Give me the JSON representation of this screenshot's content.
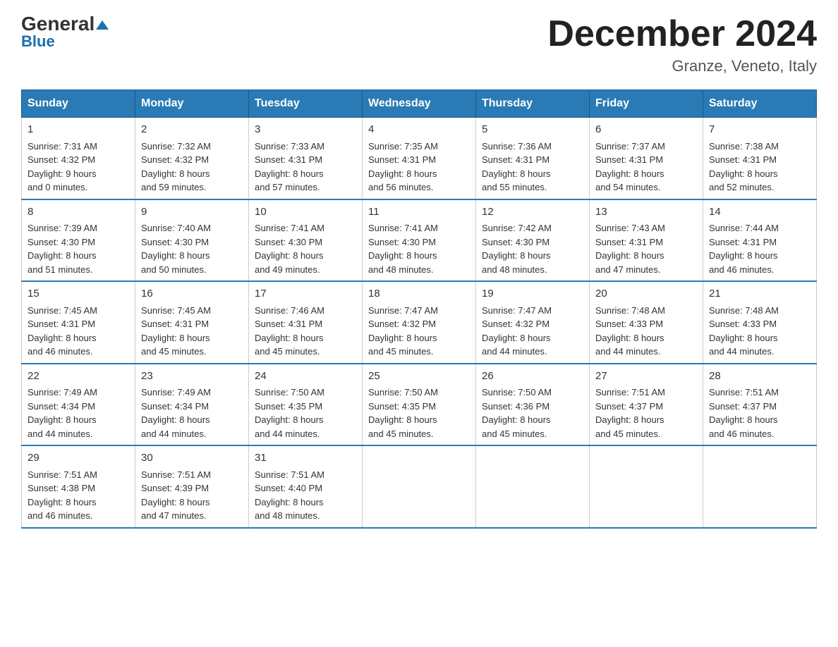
{
  "header": {
    "logo_general": "General",
    "logo_blue": "Blue",
    "main_title": "December 2024",
    "subtitle": "Granze, Veneto, Italy"
  },
  "days_of_week": [
    "Sunday",
    "Monday",
    "Tuesday",
    "Wednesday",
    "Thursday",
    "Friday",
    "Saturday"
  ],
  "weeks": [
    [
      {
        "day": "1",
        "sunrise": "7:31 AM",
        "sunset": "4:32 PM",
        "daylight": "9 hours and 0 minutes."
      },
      {
        "day": "2",
        "sunrise": "7:32 AM",
        "sunset": "4:32 PM",
        "daylight": "8 hours and 59 minutes."
      },
      {
        "day": "3",
        "sunrise": "7:33 AM",
        "sunset": "4:31 PM",
        "daylight": "8 hours and 57 minutes."
      },
      {
        "day": "4",
        "sunrise": "7:35 AM",
        "sunset": "4:31 PM",
        "daylight": "8 hours and 56 minutes."
      },
      {
        "day": "5",
        "sunrise": "7:36 AM",
        "sunset": "4:31 PM",
        "daylight": "8 hours and 55 minutes."
      },
      {
        "day": "6",
        "sunrise": "7:37 AM",
        "sunset": "4:31 PM",
        "daylight": "8 hours and 54 minutes."
      },
      {
        "day": "7",
        "sunrise": "7:38 AM",
        "sunset": "4:31 PM",
        "daylight": "8 hours and 52 minutes."
      }
    ],
    [
      {
        "day": "8",
        "sunrise": "7:39 AM",
        "sunset": "4:30 PM",
        "daylight": "8 hours and 51 minutes."
      },
      {
        "day": "9",
        "sunrise": "7:40 AM",
        "sunset": "4:30 PM",
        "daylight": "8 hours and 50 minutes."
      },
      {
        "day": "10",
        "sunrise": "7:41 AM",
        "sunset": "4:30 PM",
        "daylight": "8 hours and 49 minutes."
      },
      {
        "day": "11",
        "sunrise": "7:41 AM",
        "sunset": "4:30 PM",
        "daylight": "8 hours and 48 minutes."
      },
      {
        "day": "12",
        "sunrise": "7:42 AM",
        "sunset": "4:30 PM",
        "daylight": "8 hours and 48 minutes."
      },
      {
        "day": "13",
        "sunrise": "7:43 AM",
        "sunset": "4:31 PM",
        "daylight": "8 hours and 47 minutes."
      },
      {
        "day": "14",
        "sunrise": "7:44 AM",
        "sunset": "4:31 PM",
        "daylight": "8 hours and 46 minutes."
      }
    ],
    [
      {
        "day": "15",
        "sunrise": "7:45 AM",
        "sunset": "4:31 PM",
        "daylight": "8 hours and 46 minutes."
      },
      {
        "day": "16",
        "sunrise": "7:45 AM",
        "sunset": "4:31 PM",
        "daylight": "8 hours and 45 minutes."
      },
      {
        "day": "17",
        "sunrise": "7:46 AM",
        "sunset": "4:31 PM",
        "daylight": "8 hours and 45 minutes."
      },
      {
        "day": "18",
        "sunrise": "7:47 AM",
        "sunset": "4:32 PM",
        "daylight": "8 hours and 45 minutes."
      },
      {
        "day": "19",
        "sunrise": "7:47 AM",
        "sunset": "4:32 PM",
        "daylight": "8 hours and 44 minutes."
      },
      {
        "day": "20",
        "sunrise": "7:48 AM",
        "sunset": "4:33 PM",
        "daylight": "8 hours and 44 minutes."
      },
      {
        "day": "21",
        "sunrise": "7:48 AM",
        "sunset": "4:33 PM",
        "daylight": "8 hours and 44 minutes."
      }
    ],
    [
      {
        "day": "22",
        "sunrise": "7:49 AM",
        "sunset": "4:34 PM",
        "daylight": "8 hours and 44 minutes."
      },
      {
        "day": "23",
        "sunrise": "7:49 AM",
        "sunset": "4:34 PM",
        "daylight": "8 hours and 44 minutes."
      },
      {
        "day": "24",
        "sunrise": "7:50 AM",
        "sunset": "4:35 PM",
        "daylight": "8 hours and 44 minutes."
      },
      {
        "day": "25",
        "sunrise": "7:50 AM",
        "sunset": "4:35 PM",
        "daylight": "8 hours and 45 minutes."
      },
      {
        "day": "26",
        "sunrise": "7:50 AM",
        "sunset": "4:36 PM",
        "daylight": "8 hours and 45 minutes."
      },
      {
        "day": "27",
        "sunrise": "7:51 AM",
        "sunset": "4:37 PM",
        "daylight": "8 hours and 45 minutes."
      },
      {
        "day": "28",
        "sunrise": "7:51 AM",
        "sunset": "4:37 PM",
        "daylight": "8 hours and 46 minutes."
      }
    ],
    [
      {
        "day": "29",
        "sunrise": "7:51 AM",
        "sunset": "4:38 PM",
        "daylight": "8 hours and 46 minutes."
      },
      {
        "day": "30",
        "sunrise": "7:51 AM",
        "sunset": "4:39 PM",
        "daylight": "8 hours and 47 minutes."
      },
      {
        "day": "31",
        "sunrise": "7:51 AM",
        "sunset": "4:40 PM",
        "daylight": "8 hours and 48 minutes."
      },
      null,
      null,
      null,
      null
    ]
  ],
  "labels": {
    "sunrise": "Sunrise:",
    "sunset": "Sunset:",
    "daylight": "Daylight:"
  }
}
